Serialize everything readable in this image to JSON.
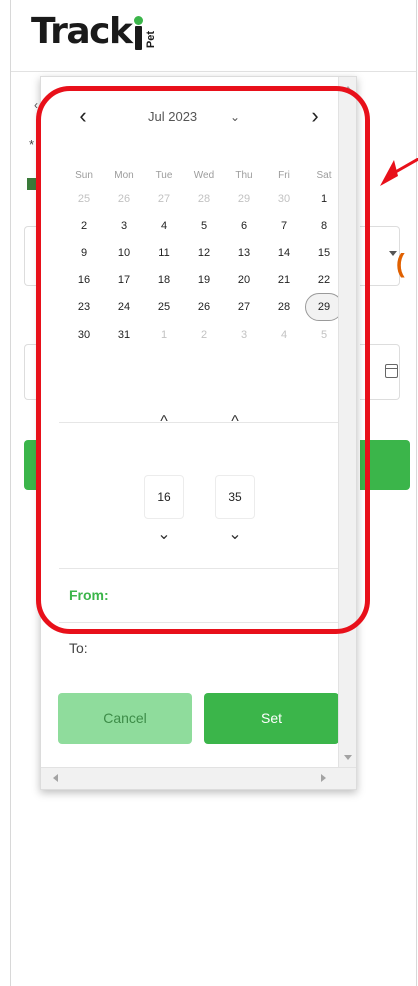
{
  "brand": {
    "logo_text": "Track",
    "logo_suffix": "Pet"
  },
  "background": {
    "back_glyph": "‹",
    "asterisk": "*"
  },
  "annotation": {
    "marker": "("
  },
  "calendar": {
    "month_label": "Jul 2023",
    "prev_glyph": "‹",
    "next_glyph": "›",
    "caret_glyph": "⌄",
    "weekdays": [
      "Sun",
      "Mon",
      "Tue",
      "Wed",
      "Thu",
      "Fri",
      "Sat"
    ],
    "weeks": [
      [
        {
          "d": "25",
          "m": true
        },
        {
          "d": "26",
          "m": true
        },
        {
          "d": "27",
          "m": true
        },
        {
          "d": "28",
          "m": true
        },
        {
          "d": "29",
          "m": true
        },
        {
          "d": "30",
          "m": true
        },
        {
          "d": "1",
          "m": false
        }
      ],
      [
        {
          "d": "2",
          "m": false
        },
        {
          "d": "3",
          "m": false
        },
        {
          "d": "4",
          "m": false
        },
        {
          "d": "5",
          "m": false
        },
        {
          "d": "6",
          "m": false
        },
        {
          "d": "7",
          "m": false
        },
        {
          "d": "8",
          "m": false
        }
      ],
      [
        {
          "d": "9",
          "m": false
        },
        {
          "d": "10",
          "m": false
        },
        {
          "d": "11",
          "m": false
        },
        {
          "d": "12",
          "m": false
        },
        {
          "d": "13",
          "m": false
        },
        {
          "d": "14",
          "m": false
        },
        {
          "d": "15",
          "m": false
        }
      ],
      [
        {
          "d": "16",
          "m": false
        },
        {
          "d": "17",
          "m": false
        },
        {
          "d": "18",
          "m": false
        },
        {
          "d": "19",
          "m": false
        },
        {
          "d": "20",
          "m": false
        },
        {
          "d": "21",
          "m": false
        },
        {
          "d": "22",
          "m": false
        }
      ],
      [
        {
          "d": "23",
          "m": false
        },
        {
          "d": "24",
          "m": false
        },
        {
          "d": "25",
          "m": false
        },
        {
          "d": "26",
          "m": false
        },
        {
          "d": "27",
          "m": false
        },
        {
          "d": "28",
          "m": false
        },
        {
          "d": "29",
          "m": false,
          "selected": true
        }
      ],
      [
        {
          "d": "30",
          "m": false
        },
        {
          "d": "31",
          "m": false
        },
        {
          "d": "1",
          "m": true
        },
        {
          "d": "2",
          "m": true
        },
        {
          "d": "3",
          "m": true
        },
        {
          "d": "4",
          "m": true
        },
        {
          "d": "5",
          "m": true
        }
      ]
    ]
  },
  "time": {
    "hour": "16",
    "minute": "35",
    "up_glyph": "^",
    "down_glyph": "⌄"
  },
  "range": {
    "from_label": "From:",
    "to_label": "To:"
  },
  "buttons": {
    "cancel": "Cancel",
    "set": "Set"
  },
  "colors": {
    "accent": "#3bb54a",
    "accent_light": "#8fdc9c",
    "annotation": "#e8101a"
  }
}
